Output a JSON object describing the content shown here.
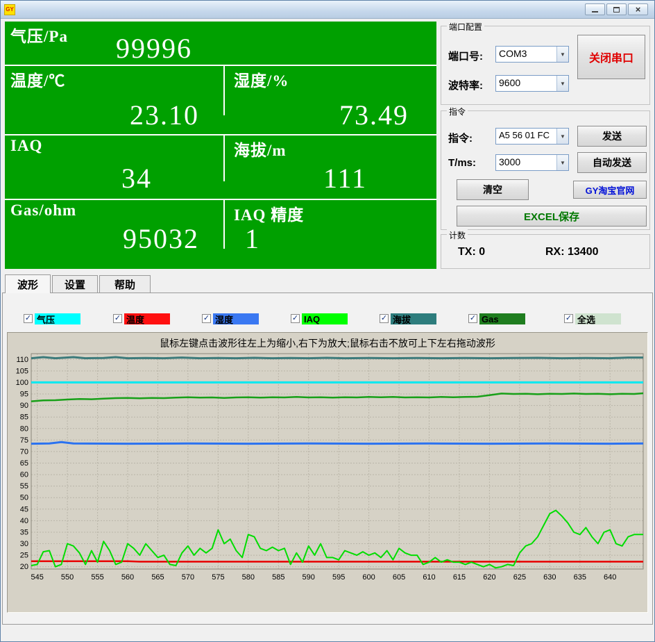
{
  "window": {
    "icon_text": "GY"
  },
  "titlebar": {
    "minimize": "minimize",
    "maximize": "maximize",
    "close": "×"
  },
  "readings": {
    "pressure": {
      "label": "气压/Pa",
      "value": "99996"
    },
    "temperature": {
      "label": "温度/℃",
      "value": "23.10"
    },
    "humidity": {
      "label": "湿度/%",
      "value": "73.49"
    },
    "iaq": {
      "label": "IAQ",
      "value": "34"
    },
    "altitude": {
      "label": "海拔/m",
      "value": "111"
    },
    "gas": {
      "label": "Gas/ohm",
      "value": "95032"
    },
    "iaq_accuracy": {
      "label": "IAQ 精度",
      "value": "1"
    }
  },
  "port_group": {
    "label": "端口配置",
    "port_label": "端口号:",
    "port_value": "COM3",
    "baud_label": "波特率:",
    "baud_value": "9600",
    "close_button": "关闭串口"
  },
  "cmd_group": {
    "label": "指令",
    "cmd_label": "指令:",
    "cmd_value": "A5 56 01 FC",
    "send_button": "发送",
    "tms_label": "T/ms:",
    "tms_value": "3000",
    "auto_send_button": "自动发送",
    "clear_button": "清空",
    "taobao_button": "GY淘宝官网",
    "excel_button": "EXCEL保存"
  },
  "count_group": {
    "label": "计数",
    "tx": "TX: 0",
    "rx": "RX: 13400"
  },
  "tabs": [
    {
      "label": "波形"
    },
    {
      "label": "设置"
    },
    {
      "label": "帮助"
    }
  ],
  "legend": [
    {
      "label": "气压",
      "color": "#00ffff",
      "checked": true
    },
    {
      "label": "温度",
      "color": "#ff1010",
      "checked": true
    },
    {
      "label": "湿度",
      "color": "#3a78f2",
      "checked": true
    },
    {
      "label": "IAQ",
      "color": "#00ff00",
      "checked": true
    },
    {
      "label": "海拔",
      "color": "#2e7d7d",
      "checked": true
    },
    {
      "label": "Gas",
      "color": "#1f7d1f",
      "checked": true
    },
    {
      "label": "全选",
      "color": "#cfe3cf",
      "checked": true
    }
  ],
  "chart_data": {
    "type": "line",
    "title": "鼠标左键点击波形往左上为缩小,右下为放大;鼠标右击不放可上下左右拖动波形",
    "xlim": [
      544,
      645.5
    ],
    "ylim": [
      19,
      112.5
    ],
    "x_ticks": [
      545,
      550,
      555,
      560,
      565,
      570,
      575,
      580,
      585,
      590,
      595,
      600,
      605,
      610,
      615,
      620,
      625,
      630,
      635,
      640
    ],
    "y_ticks": [
      20,
      25,
      30,
      35,
      40,
      45,
      50,
      55,
      60,
      65,
      70,
      75,
      80,
      85,
      90,
      95,
      100,
      105,
      110
    ],
    "grid": true,
    "legend_position": "top-external",
    "series": [
      {
        "name": "海拔",
        "color": "#3d7b7b",
        "width": 3,
        "points": [
          [
            544,
            110.5
          ],
          [
            546,
            111
          ],
          [
            548,
            110.5
          ],
          [
            551,
            111
          ],
          [
            553,
            110.5
          ],
          [
            556,
            110.6
          ],
          [
            558,
            111
          ],
          [
            560,
            110.5
          ],
          [
            563,
            110.6
          ],
          [
            566,
            110.5
          ],
          [
            569,
            110.8
          ],
          [
            572,
            110.5
          ],
          [
            575,
            110.6
          ],
          [
            578,
            110.5
          ],
          [
            581,
            110.7
          ],
          [
            584,
            110.5
          ],
          [
            587,
            110.6
          ],
          [
            590,
            110.5
          ],
          [
            593,
            110.7
          ],
          [
            596,
            110.5
          ],
          [
            600,
            110.6
          ],
          [
            604,
            110.5
          ],
          [
            608,
            110.6
          ],
          [
            612,
            110.5
          ],
          [
            616,
            110.6
          ],
          [
            620,
            110.5
          ],
          [
            624,
            110.6
          ],
          [
            628,
            110.7
          ],
          [
            632,
            110.5
          ],
          [
            636,
            110.6
          ],
          [
            640,
            110.5
          ],
          [
            643,
            110.8
          ],
          [
            645.5,
            110.8
          ]
        ]
      },
      {
        "name": "气压",
        "color": "#00e8f0",
        "width": 3,
        "points": [
          [
            544,
            100
          ],
          [
            645.5,
            100
          ]
        ]
      },
      {
        "name": "Gas",
        "color": "#18a018",
        "width": 2.5,
        "points": [
          [
            544,
            91.8
          ],
          [
            546,
            92.2
          ],
          [
            548,
            92.3
          ],
          [
            550,
            92.6
          ],
          [
            552,
            92.8
          ],
          [
            554,
            92.7
          ],
          [
            556,
            93
          ],
          [
            558,
            93.2
          ],
          [
            560,
            93.3
          ],
          [
            562,
            93.1
          ],
          [
            564,
            93.3
          ],
          [
            566,
            93.2
          ],
          [
            568,
            93.4
          ],
          [
            570,
            93.6
          ],
          [
            572,
            93.4
          ],
          [
            574,
            93.5
          ],
          [
            576,
            93.3
          ],
          [
            578,
            93.5
          ],
          [
            580,
            93.6
          ],
          [
            582,
            93.4
          ],
          [
            584,
            93.6
          ],
          [
            586,
            93.5
          ],
          [
            588,
            93.7
          ],
          [
            590,
            93.5
          ],
          [
            592,
            93.6
          ],
          [
            594,
            93.4
          ],
          [
            596,
            93.6
          ],
          [
            598,
            93.5
          ],
          [
            600,
            93.7
          ],
          [
            602,
            93.6
          ],
          [
            604,
            93.7
          ],
          [
            606,
            93.5
          ],
          [
            608,
            93.6
          ],
          [
            610,
            93.5
          ],
          [
            612,
            93.7
          ],
          [
            614,
            93.6
          ],
          [
            616,
            93.7
          ],
          [
            618,
            93.8
          ],
          [
            620,
            94.5
          ],
          [
            622,
            95.2
          ],
          [
            624,
            95
          ],
          [
            626,
            95.1
          ],
          [
            628,
            94.9
          ],
          [
            630,
            95.1
          ],
          [
            632,
            95
          ],
          [
            634,
            95.2
          ],
          [
            636,
            95
          ],
          [
            638,
            95.1
          ],
          [
            640,
            94.9
          ],
          [
            642,
            95.1
          ],
          [
            644,
            95
          ],
          [
            645.5,
            95.3
          ]
        ]
      },
      {
        "name": "湿度",
        "color": "#2b72f0",
        "width": 3,
        "points": [
          [
            544,
            73.4
          ],
          [
            547,
            73.5
          ],
          [
            549,
            74.1
          ],
          [
            551,
            73.5
          ],
          [
            560,
            73.4
          ],
          [
            570,
            73.5
          ],
          [
            580,
            73.4
          ],
          [
            590,
            73.5
          ],
          [
            600,
            73.4
          ],
          [
            610,
            73.5
          ],
          [
            620,
            73.4
          ],
          [
            630,
            73.5
          ],
          [
            640,
            73.4
          ],
          [
            645.5,
            73.5
          ]
        ]
      },
      {
        "name": "温度",
        "color": "#e80000",
        "width": 2.5,
        "points": [
          [
            544,
            22.4
          ],
          [
            560,
            22.4
          ],
          [
            562,
            22.2
          ],
          [
            600,
            22.2
          ],
          [
            645.5,
            22.2
          ]
        ]
      },
      {
        "name": "IAQ",
        "color": "#00dd00",
        "width": 2,
        "points": [
          [
            544,
            20.5
          ],
          [
            545,
            21
          ],
          [
            546,
            26.5
          ],
          [
            547,
            27
          ],
          [
            548,
            20
          ],
          [
            549,
            21
          ],
          [
            550,
            30
          ],
          [
            551,
            29
          ],
          [
            552,
            26
          ],
          [
            553,
            21
          ],
          [
            554,
            27
          ],
          [
            555,
            22
          ],
          [
            556,
            31
          ],
          [
            557,
            27
          ],
          [
            558,
            21
          ],
          [
            559,
            22
          ],
          [
            560,
            30
          ],
          [
            561,
            28
          ],
          [
            562,
            25
          ],
          [
            563,
            30
          ],
          [
            564,
            27
          ],
          [
            565,
            24
          ],
          [
            566,
            25
          ],
          [
            567,
            21
          ],
          [
            568,
            20.5
          ],
          [
            569,
            26
          ],
          [
            570,
            29
          ],
          [
            571,
            25
          ],
          [
            572,
            28
          ],
          [
            573,
            26
          ],
          [
            574,
            28
          ],
          [
            575,
            36
          ],
          [
            576,
            30
          ],
          [
            577,
            32
          ],
          [
            578,
            27
          ],
          [
            579,
            24
          ],
          [
            580,
            34
          ],
          [
            581,
            33
          ],
          [
            582,
            28
          ],
          [
            583,
            27
          ],
          [
            584,
            28.5
          ],
          [
            585,
            27
          ],
          [
            586,
            28
          ],
          [
            587,
            21
          ],
          [
            588,
            26
          ],
          [
            589,
            22
          ],
          [
            590,
            29
          ],
          [
            591,
            25
          ],
          [
            592,
            30
          ],
          [
            593,
            24
          ],
          [
            594,
            24
          ],
          [
            595,
            23
          ],
          [
            596,
            27
          ],
          [
            597,
            26
          ],
          [
            598,
            25
          ],
          [
            599,
            26.5
          ],
          [
            600,
            25
          ],
          [
            601,
            26
          ],
          [
            602,
            24
          ],
          [
            603,
            27
          ],
          [
            604,
            23
          ],
          [
            605,
            28
          ],
          [
            606,
            26
          ],
          [
            607,
            25
          ],
          [
            608,
            25
          ],
          [
            609,
            21
          ],
          [
            610,
            22
          ],
          [
            611,
            24
          ],
          [
            612,
            22
          ],
          [
            613,
            23
          ],
          [
            614,
            22
          ],
          [
            615,
            22
          ],
          [
            616,
            21
          ],
          [
            617,
            22
          ],
          [
            618,
            21
          ],
          [
            619,
            20
          ],
          [
            620,
            21
          ],
          [
            621,
            19.5
          ],
          [
            622,
            20
          ],
          [
            623,
            21
          ],
          [
            624,
            20.5
          ],
          [
            625,
            26
          ],
          [
            626,
            29
          ],
          [
            627,
            30
          ],
          [
            628,
            33
          ],
          [
            629,
            38
          ],
          [
            630,
            43
          ],
          [
            631,
            44.5
          ],
          [
            632,
            42
          ],
          [
            633,
            39
          ],
          [
            634,
            35
          ],
          [
            635,
            34
          ],
          [
            636,
            37
          ],
          [
            637,
            33
          ],
          [
            638,
            30
          ],
          [
            639,
            35
          ],
          [
            640,
            36
          ],
          [
            641,
            30
          ],
          [
            642,
            29
          ],
          [
            643,
            33
          ],
          [
            644,
            34
          ],
          [
            645.5,
            34
          ]
        ]
      }
    ]
  }
}
